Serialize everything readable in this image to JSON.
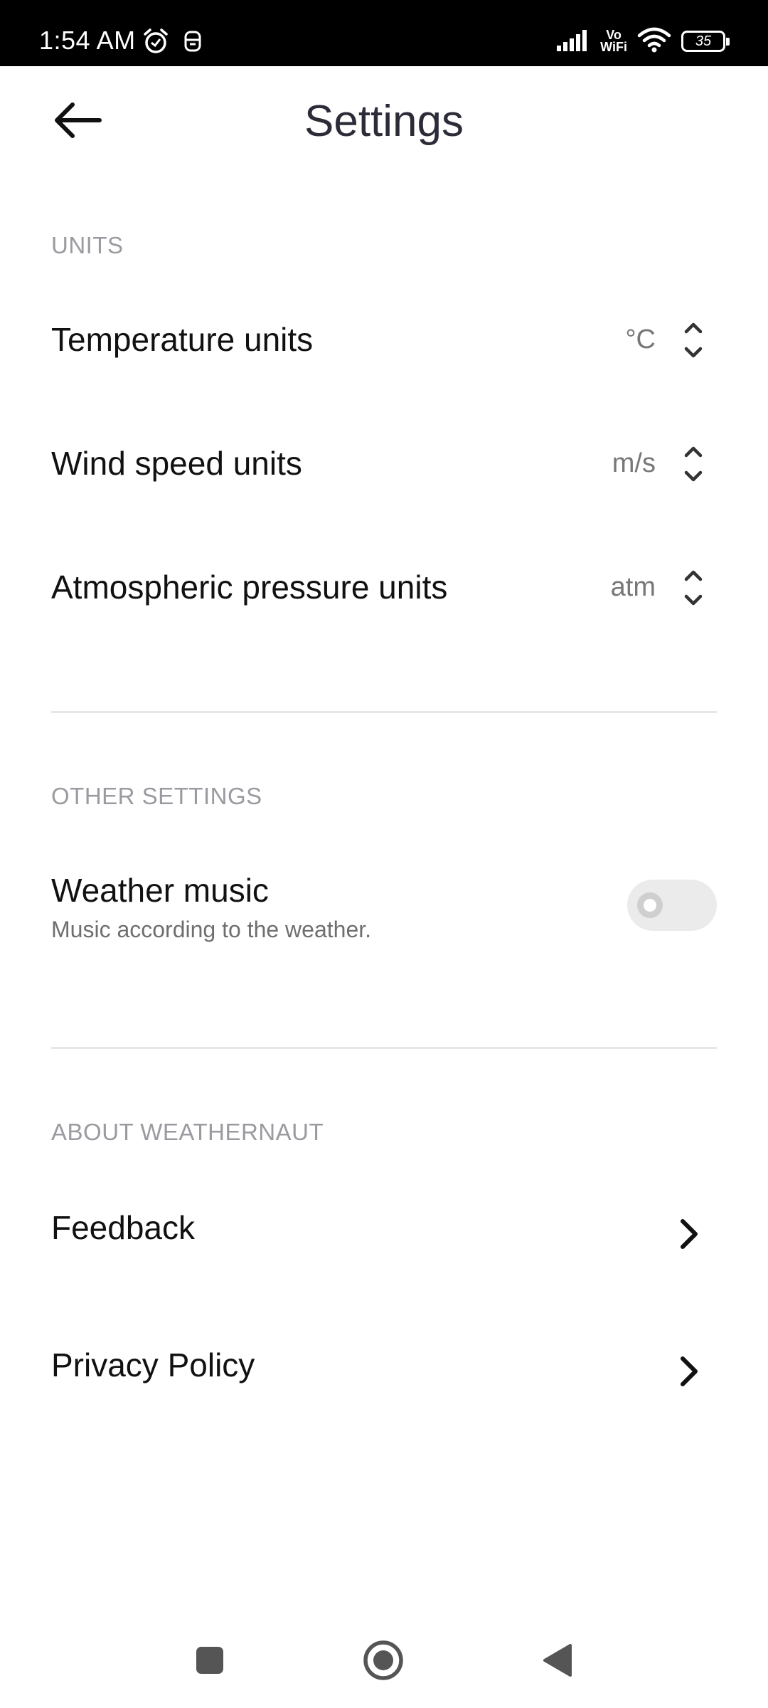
{
  "status_bar": {
    "time": "1:54 AM",
    "vowifi_top": "Vo",
    "vowifi_bottom": "WiFi",
    "battery_level": "35"
  },
  "header": {
    "title": "Settings",
    "back_icon": "arrow-left-icon"
  },
  "sections": {
    "units": {
      "header": "UNITS",
      "items": [
        {
          "label": "Temperature units",
          "value": "°C",
          "icon": "up-down-chevron-icon"
        },
        {
          "label": "Wind speed units",
          "value": "m/s",
          "icon": "up-down-chevron-icon"
        },
        {
          "label": "Atmospheric pressure units",
          "value": "atm",
          "icon": "up-down-chevron-icon"
        }
      ]
    },
    "other": {
      "header": "OTHER SETTINGS",
      "weather_music": {
        "label": "Weather music",
        "description": "Music according to the weather.",
        "enabled": false
      }
    },
    "about": {
      "header": "ABOUT WEATHERNAUT",
      "items": [
        {
          "label": "Feedback",
          "icon": "chevron-right-icon"
        },
        {
          "label": "Privacy Policy",
          "icon": "chevron-right-icon"
        }
      ]
    }
  },
  "colors": {
    "title": "#2c2c38",
    "section_header": "#9a9aa0",
    "value_text": "#777777",
    "divider": "#e6e6e6",
    "toggle_track_off": "#ebebeb"
  },
  "nav_bar": {
    "icons": [
      "recents-square-icon",
      "home-circle-icon",
      "back-triangle-icon"
    ]
  }
}
